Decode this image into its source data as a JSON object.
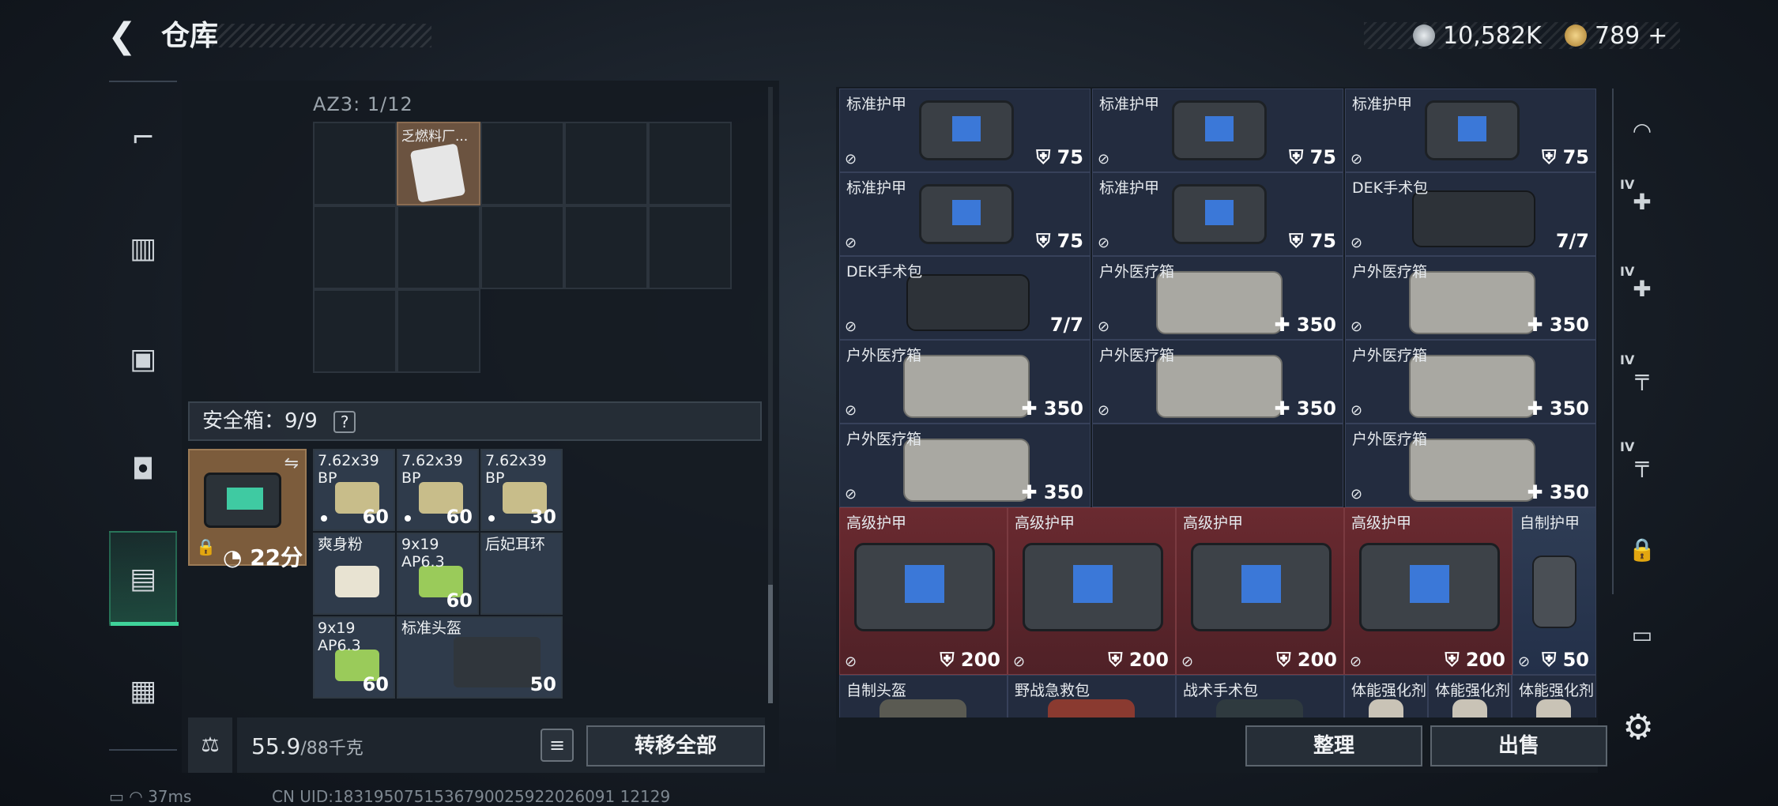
{
  "header": {
    "title": "仓库"
  },
  "currency": {
    "silver": "10,582K",
    "gold": "789",
    "gold_plus": "+"
  },
  "left_nav": [
    {
      "icon": "pistol-icon"
    },
    {
      "icon": "vest-icon"
    },
    {
      "icon": "backpack-icon"
    },
    {
      "icon": "pouch-icon"
    },
    {
      "icon": "safebox-icon"
    },
    {
      "icon": "briefcase-icon"
    }
  ],
  "container": {
    "label": "AZ3: 1/12",
    "item_name": "乏燃料厂..."
  },
  "safe_box": {
    "header": "安全箱：9/9",
    "help": "?",
    "timer": "22分",
    "items": [
      {
        "name": "7.62x39\nBP",
        "qty": "60"
      },
      {
        "name": "7.62x39\nBP",
        "qty": "60"
      },
      {
        "name": "7.62x39\nBP",
        "qty": "30"
      },
      {
        "name": "爽身粉",
        "qty": ""
      },
      {
        "name": "9x19\nAP6.3",
        "qty": "60"
      },
      {
        "name": "后妃耳环",
        "qty": ""
      },
      {
        "name": "9x19\nAP6.3",
        "qty": "60"
      },
      {
        "name": "标准头盔",
        "qty": "50"
      }
    ]
  },
  "weight": {
    "value": "55.9",
    "max": "/88千克"
  },
  "buttons": {
    "transfer_all": "转移全部",
    "sort": "整理",
    "sell": "出售",
    "list": "≡"
  },
  "stash": {
    "rows": [
      [
        {
          "name": "标准护甲",
          "val": "75",
          "kind": "armor"
        },
        {
          "name": "标准护甲",
          "val": "75",
          "kind": "armor"
        },
        {
          "name": "标准护甲",
          "val": "75",
          "kind": "armor"
        }
      ],
      [
        {
          "name": "标准护甲",
          "val": "75",
          "kind": "armor"
        },
        {
          "name": "标准护甲",
          "val": "75",
          "kind": "armor"
        },
        {
          "name": "DEK手术包",
          "val": "7/7",
          "kind": "kit"
        }
      ],
      [
        {
          "name": "DEK手术包",
          "val": "7/7",
          "kind": "kit"
        },
        {
          "name": "户外医疗箱",
          "val": "350",
          "kind": "med"
        },
        {
          "name": "户外医疗箱",
          "val": "350",
          "kind": "med"
        }
      ],
      [
        {
          "name": "户外医疗箱",
          "val": "350",
          "kind": "med"
        },
        {
          "name": "户外医疗箱",
          "val": "350",
          "kind": "med"
        },
        {
          "name": "户外医疗箱",
          "val": "350",
          "kind": "med"
        }
      ],
      [
        {
          "name": "户外医疗箱",
          "val": "350",
          "kind": "med"
        },
        {
          "name": "",
          "val": "",
          "kind": "empty"
        },
        {
          "name": "户外医疗箱",
          "val": "350",
          "kind": "med"
        }
      ]
    ],
    "advanced": [
      {
        "name": "高级护甲",
        "val": "200"
      },
      {
        "name": "高级护甲",
        "val": "200"
      },
      {
        "name": "高级护甲",
        "val": "200"
      },
      {
        "name": "高级护甲",
        "val": "200"
      },
      {
        "name": "自制护甲",
        "val": "50"
      }
    ],
    "bottom_row": [
      "自制头盔",
      "野战急救包",
      "战术手术包",
      "体能强化剂",
      "体能强化剂",
      "体能强化剂"
    ]
  },
  "right_nav": [
    {
      "icon": "helmet-icon",
      "label": ""
    },
    {
      "icon": "medkit-add-icon",
      "label": "IV"
    },
    {
      "icon": "medkit-add-icon",
      "label": "IV"
    },
    {
      "icon": "rifle-icon",
      "label": "IV"
    },
    {
      "icon": "rifle-icon",
      "label": "IV"
    },
    {
      "icon": "lock-icon",
      "label": ""
    },
    {
      "icon": "tag-icon",
      "label": ""
    }
  ],
  "status": {
    "ping": "37ms",
    "uid": "CN UID:1831950751536790025922026091 12129"
  },
  "colors": {
    "accent": "#3fd39a",
    "advanced_bg": "#6a2a30",
    "cell_bg": "#232c3f"
  }
}
